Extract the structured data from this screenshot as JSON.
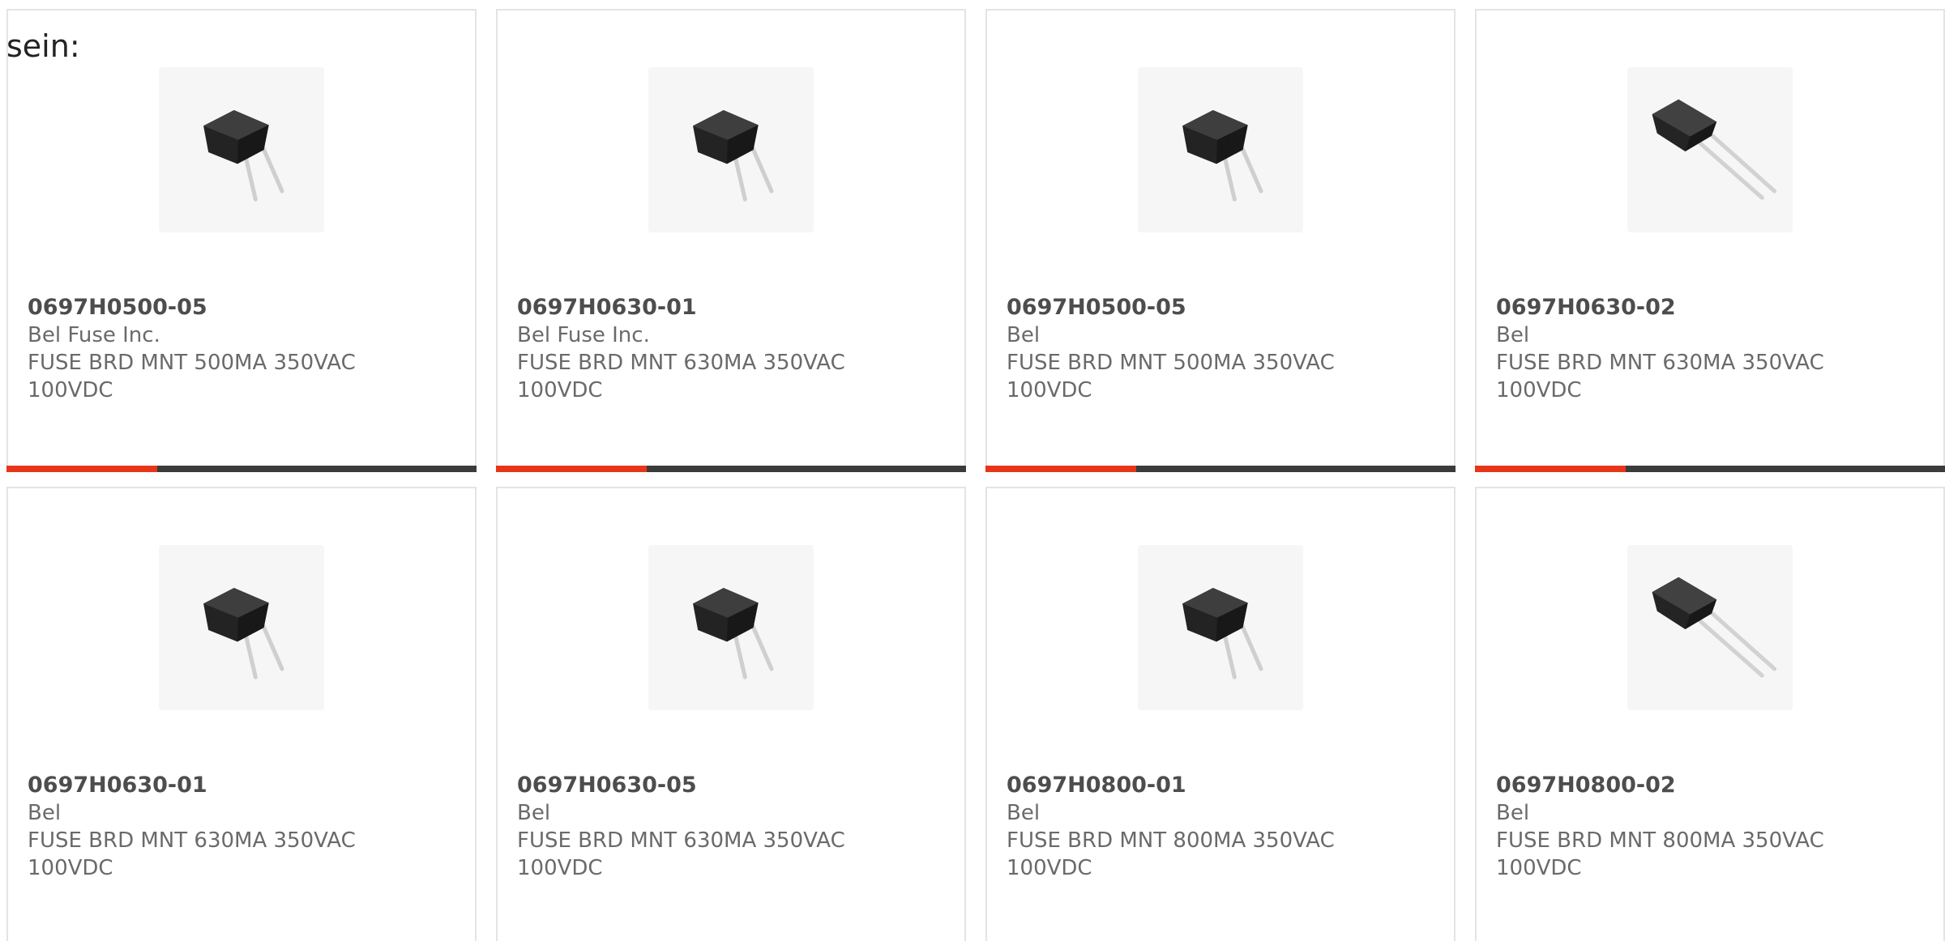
{
  "intro_text": "sein:",
  "accent_color": "#e6361a",
  "bar_color": "#3b3b3b",
  "cards": [
    {
      "part": "0697H0500-05",
      "maker": "Bel Fuse Inc.",
      "desc1": "FUSE BRD MNT 500MA 350VAC",
      "desc2": "100VDC",
      "image": "radial-fuse-upright",
      "progress": 0.32
    },
    {
      "part": "0697H0630-01",
      "maker": "Bel Fuse Inc.",
      "desc1": "FUSE BRD MNT 630MA 350VAC",
      "desc2": "100VDC",
      "image": "radial-fuse-upright",
      "progress": 0.32
    },
    {
      "part": "0697H0500-05",
      "maker": "Bel",
      "desc1": "FUSE BRD MNT 500MA 350VAC",
      "desc2": "100VDC",
      "image": "radial-fuse-upright",
      "progress": 0.32
    },
    {
      "part": "0697H0630-02",
      "maker": "Bel",
      "desc1": "FUSE BRD MNT 630MA 350VAC",
      "desc2": "100VDC",
      "image": "radial-fuse-angled",
      "progress": 0.32
    },
    {
      "part": "0697H0630-01",
      "maker": "Bel",
      "desc1": "FUSE BRD MNT 630MA 350VAC",
      "desc2": "100VDC",
      "image": "radial-fuse-upright"
    },
    {
      "part": "0697H0630-05",
      "maker": "Bel",
      "desc1": "FUSE BRD MNT 630MA 350VAC",
      "desc2": "100VDC",
      "image": "radial-fuse-upright"
    },
    {
      "part": "0697H0800-01",
      "maker": "Bel",
      "desc1": "FUSE BRD MNT 800MA 350VAC",
      "desc2": "100VDC",
      "image": "radial-fuse-upright"
    },
    {
      "part": "0697H0800-02",
      "maker": "Bel",
      "desc1": "FUSE BRD MNT 800MA 350VAC",
      "desc2": "100VDC",
      "image": "radial-fuse-angled"
    }
  ]
}
